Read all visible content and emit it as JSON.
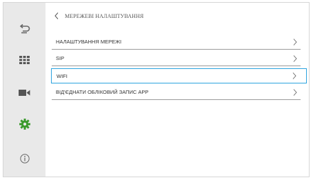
{
  "header": {
    "title": "МЕРЕЖЕВІ НАЛАШТУВАННЯ"
  },
  "sidebar": {
    "items": [
      {
        "icon": "return-icon",
        "color": "#666666"
      },
      {
        "icon": "grid-icon",
        "color": "#555555"
      },
      {
        "icon": "camera-icon",
        "color": "#555555"
      },
      {
        "icon": "gear-icon",
        "color": "#3b9a2c"
      },
      {
        "icon": "info-icon",
        "color": "#666666"
      }
    ],
    "active": "gear-icon"
  },
  "menu": {
    "items": [
      {
        "label": "НАЛАШТУВАННЯ МЕРЕЖІ"
      },
      {
        "label": "SIP"
      },
      {
        "label": "WIFI",
        "selected": true
      },
      {
        "label": "ВІД'ЄДНАТИ ОБЛІКОВИЙ ЗАПИС APP"
      }
    ]
  },
  "colors": {
    "sidebar_bg": "#e9e9e9",
    "active_icon": "#3b9a2c",
    "selection_border": "#2aa3df",
    "divider": "#9a9a9a"
  }
}
